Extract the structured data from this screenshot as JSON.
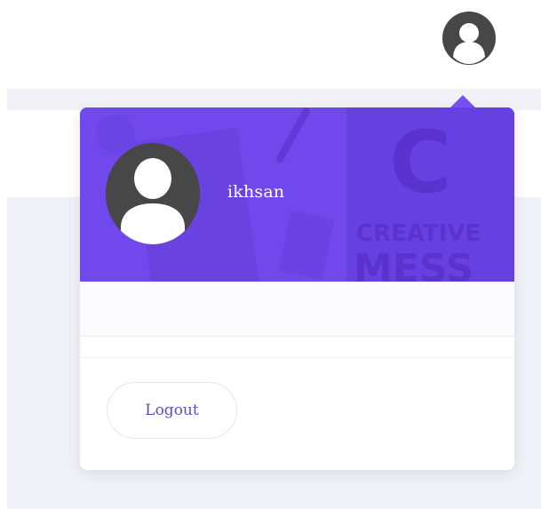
{
  "header": {
    "avatar_icon": "user-avatar-icon"
  },
  "dropdown": {
    "username": "ikhsan",
    "avatar_icon": "user-avatar-icon",
    "background_art_text": [
      "C",
      "CREATIVE",
      "MESS"
    ],
    "logout_label": "Logout"
  },
  "colors": {
    "header_purple": "#7048ec",
    "avatar_dark": "#474747",
    "logout_text": "#5b4fc2",
    "page_band": "#f1f1f8"
  }
}
